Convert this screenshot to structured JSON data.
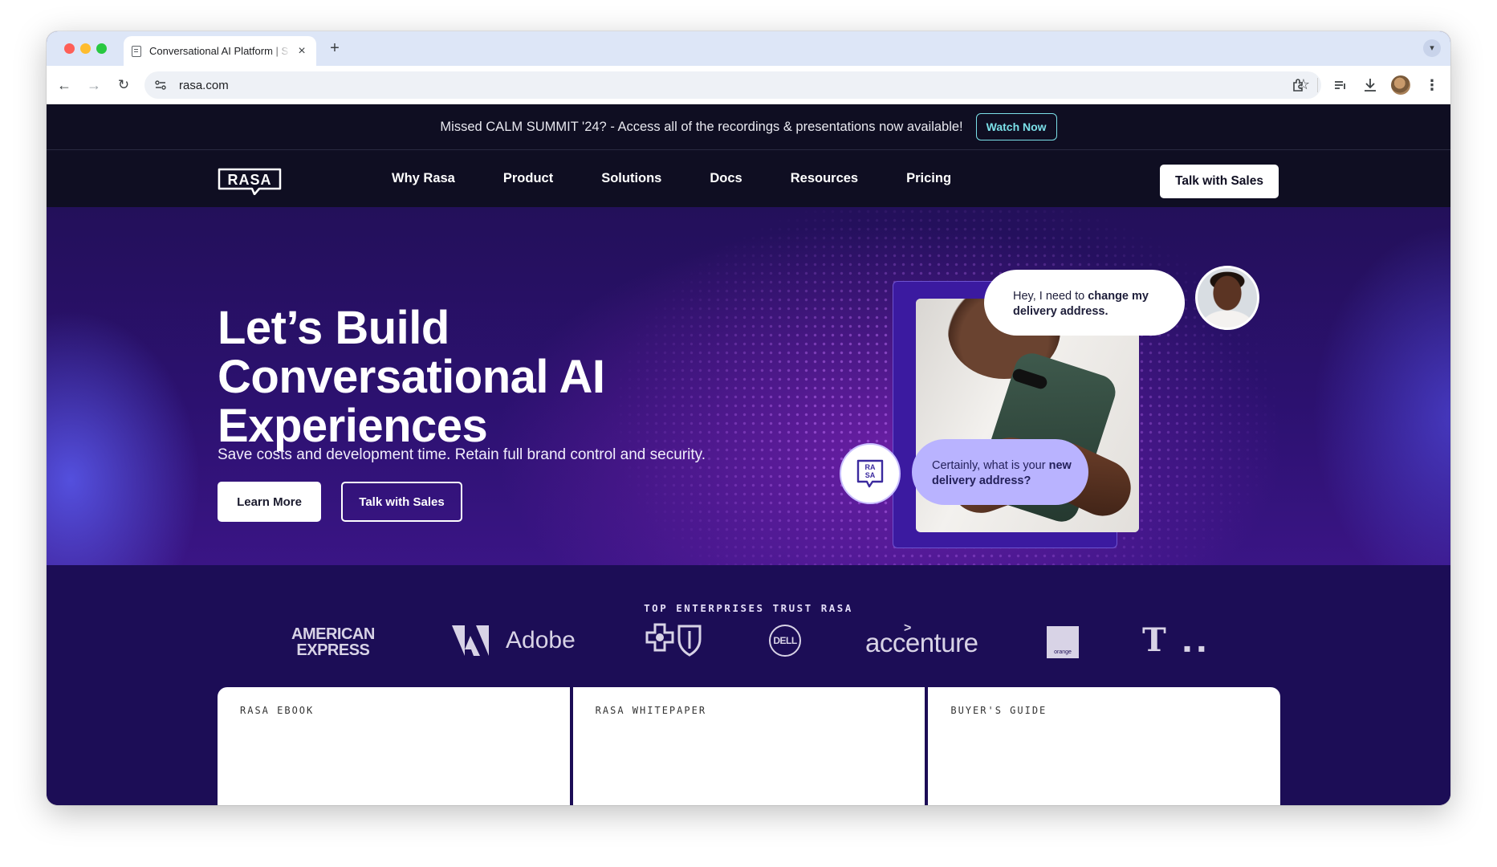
{
  "browser": {
    "tab_title": "Conversational AI Platform | S",
    "url": "rasa.com"
  },
  "announcement": {
    "message": "Missed CALM SUMMIT '24? - Access all of the recordings & presentations now available!",
    "cta": "Watch Now"
  },
  "nav": {
    "logo_text": "RASA",
    "links": [
      "Why Rasa",
      "Product",
      "Solutions",
      "Docs",
      "Resources",
      "Pricing"
    ],
    "cta": "Talk with Sales"
  },
  "hero": {
    "title_line1": "Let’s Build",
    "title_line2": "Conversational AI",
    "title_line3": "Experiences",
    "subtitle": "Save costs and development time. Retain full brand control and security.",
    "primary_button": "Learn More",
    "secondary_button": "Talk with Sales",
    "user_message_plain": "Hey, I need to ",
    "user_message_bold": "change my delivery address.",
    "bot_message_plain": "Certainly, what is your ",
    "bot_message_bold": "new delivery address?"
  },
  "trust": {
    "title": "TOP ENTERPRISES TRUST RASA",
    "logos": {
      "amex_line1": "AMERICAN",
      "amex_line2": "EXPRESS",
      "adobe": "Adobe",
      "dell": "DELL",
      "accenture": "accenture",
      "orange": "orange"
    }
  },
  "cards": [
    "RASA EBOOK",
    "RASA WHITEPAPER",
    "BUYER'S GUIDE"
  ],
  "colors": {
    "nav_bg": "#0f0e22",
    "hero_bg": "#2c1170",
    "trust_bg": "#1c0d56",
    "watch_now_accent": "#7be0e8",
    "bot_bubble": "#b9b3ff"
  }
}
